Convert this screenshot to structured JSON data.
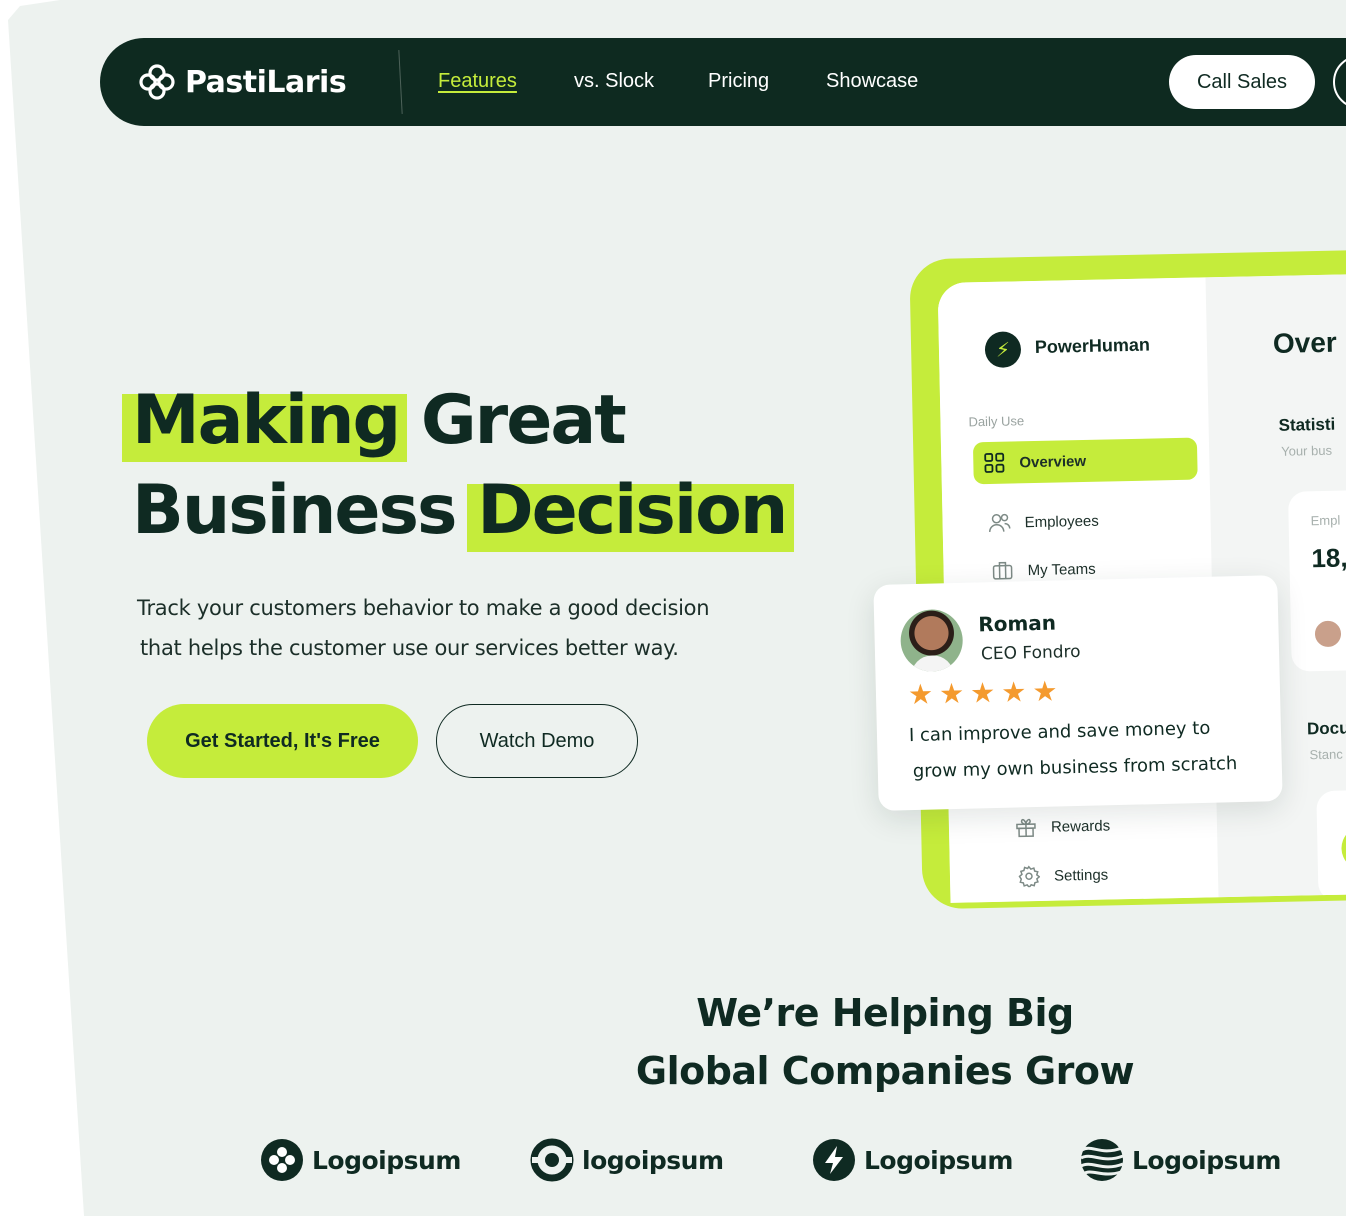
{
  "nav": {
    "brand": "PastiLaris",
    "links": [
      {
        "label": "Features",
        "active": true
      },
      {
        "label": "vs. Slock",
        "active": false
      },
      {
        "label": "Pricing",
        "active": false
      },
      {
        "label": "Showcase",
        "active": false
      }
    ],
    "call_sales": "Call Sales"
  },
  "hero": {
    "title_line1_highlight": "Making",
    "title_line1_rest": " Great",
    "title_line2_rest": "Business ",
    "title_line2_highlight": "Decision",
    "subtitle_line1": "Track your customers behavior to make a good decision",
    "subtitle_line2": "that helps the customer use our services better way.",
    "primary_cta": "Get Started, It's Free",
    "secondary_cta": "Watch Demo"
  },
  "dashboard": {
    "app_name": "PowerHuman",
    "section_label": "Daily Use",
    "menu": [
      {
        "label": "Overview",
        "icon": "grid-icon",
        "active": true
      },
      {
        "label": "Employees",
        "icon": "users-icon",
        "active": false
      },
      {
        "label": "My Teams",
        "icon": "briefcase-icon",
        "active": false
      },
      {
        "label": "Rewards",
        "icon": "gift-icon",
        "active": false
      },
      {
        "label": "Settings",
        "icon": "gear-icon",
        "active": false
      }
    ],
    "main_title": "Over",
    "stat_title": "Statisti",
    "stat_sub": "Your bus",
    "card_label": "Empl",
    "card_value": "18,",
    "doc_title": "Docu",
    "doc_sub": "Stanc"
  },
  "testimonial": {
    "name": "Roman",
    "role": "CEO Fondro",
    "rating": 5,
    "quote_line1": "I can improve and save money to",
    "quote_line2": "grow my own business from scratch"
  },
  "partners": {
    "title_line1": "We’re Helping Big",
    "title_line2": "Global Companies Grow",
    "logos": [
      {
        "name": "Logoipsum",
        "icon": "clover-logo-icon"
      },
      {
        "name": "logoipsum",
        "icon": "ring-logo-icon"
      },
      {
        "name": "Logoipsum",
        "icon": "bolt-logo-icon"
      },
      {
        "name": "Logoipsum",
        "icon": "waves-logo-icon"
      }
    ]
  },
  "colors": {
    "brand_dark": "#0e2a20",
    "accent_lime": "#c5ec3b",
    "background": "#edf2ef",
    "star": "#f49a2e"
  }
}
